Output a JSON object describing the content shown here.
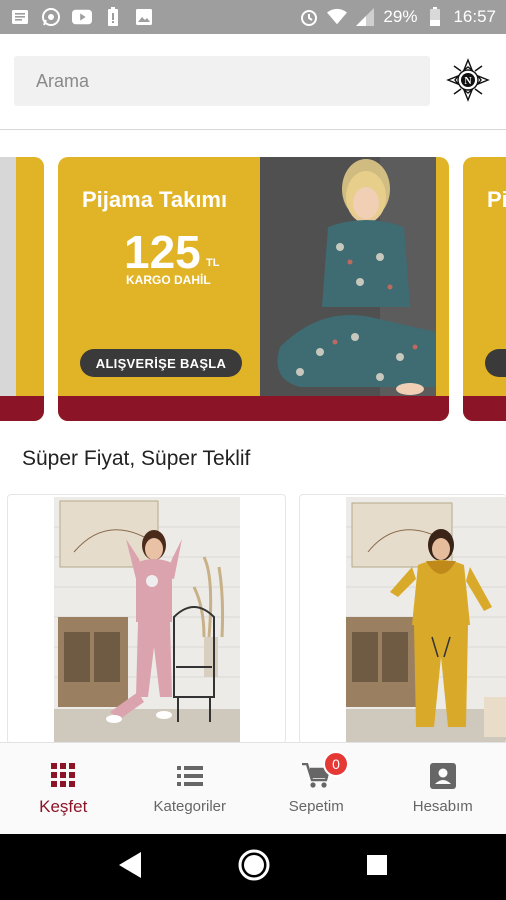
{
  "status_bar": {
    "battery": "29%",
    "time": "16:57",
    "icons": [
      "message-icon",
      "whatsapp-icon",
      "youtube-icon",
      "battery-alert-icon",
      "image-icon",
      "alarm-icon",
      "wifi-icon",
      "signal-icon",
      "battery-icon"
    ]
  },
  "search": {
    "placeholder": "Arama"
  },
  "banner": {
    "title": "Pijama Takımı",
    "price": "125",
    "currency": "TL",
    "shipping": "KARGO DAHİL",
    "button": "ALIŞVERİŞE BAŞLA",
    "partial_title": "Pi"
  },
  "section": {
    "title": "Süper Fiyat, Süper Teklif"
  },
  "bottom_nav": {
    "items": [
      {
        "label": "Keşfet",
        "icon": "grid-icon"
      },
      {
        "label": "Kategoriler",
        "icon": "list-icon"
      },
      {
        "label": "Sepetim",
        "icon": "cart-icon"
      },
      {
        "label": "Hesabım",
        "icon": "account-icon"
      }
    ],
    "cart_count": "0"
  },
  "colors": {
    "accent": "#8c1427",
    "banner_yellow": "#e1b327",
    "badge": "#e53935"
  }
}
